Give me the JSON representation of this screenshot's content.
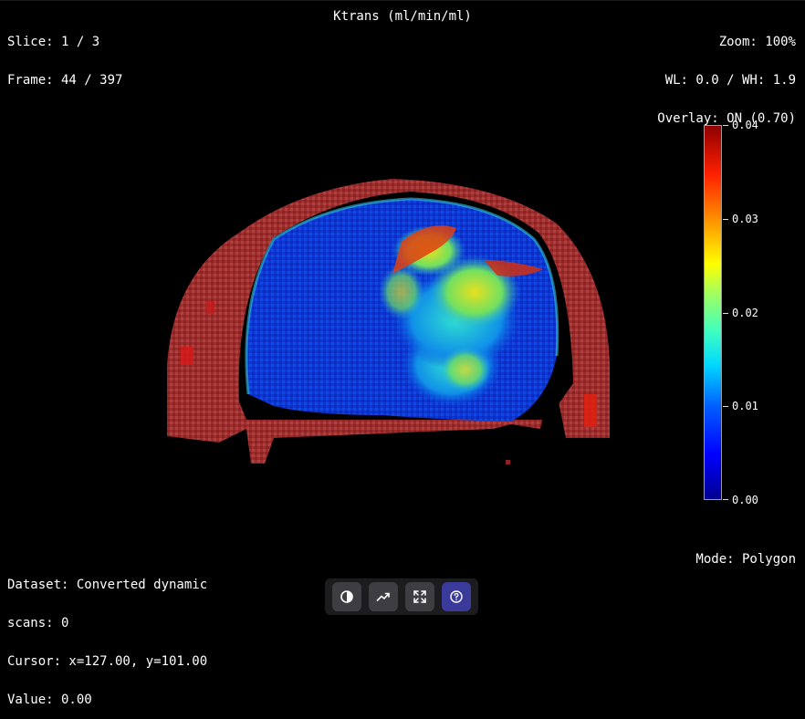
{
  "overlay_info": {
    "slice": "Slice: 1 / 3",
    "frame": "Frame: 44 / 397",
    "title": "Ktrans (ml/min/ml)",
    "zoom": "Zoom: 100%",
    "window": "WL: 0.0 / WH: 1.9",
    "overlay": "Overlay: ON (0.70)",
    "dataset_line1": "Dataset: Converted dynamic",
    "dataset_line2": "scans: 0",
    "cursor": "Cursor: x=127.00, y=101.00",
    "value": "Value: 0.00",
    "mode": "Mode: Polygon"
  },
  "colorbar": {
    "min": 0.0,
    "max": 0.04,
    "ticks": [
      "0.04",
      "0.03",
      "0.02",
      "0.01",
      "0.00"
    ],
    "colormap": "jet"
  },
  "toolbar": {
    "buttons": [
      {
        "name": "contrast-button",
        "icon": "contrast-icon",
        "active": false
      },
      {
        "name": "timecurve-button",
        "icon": "trend-line-icon",
        "active": false
      },
      {
        "name": "fullscreen-button",
        "icon": "expand-icon",
        "active": false
      },
      {
        "name": "help-button",
        "icon": "help-circle-icon",
        "active": true
      }
    ]
  },
  "colors": {
    "background": "#000000",
    "toolbar_bg": "#1c1c1e",
    "button_bg": "#3e3e42",
    "button_active": "#3a3a9a",
    "anatomy_tint": "#a83a3a"
  }
}
